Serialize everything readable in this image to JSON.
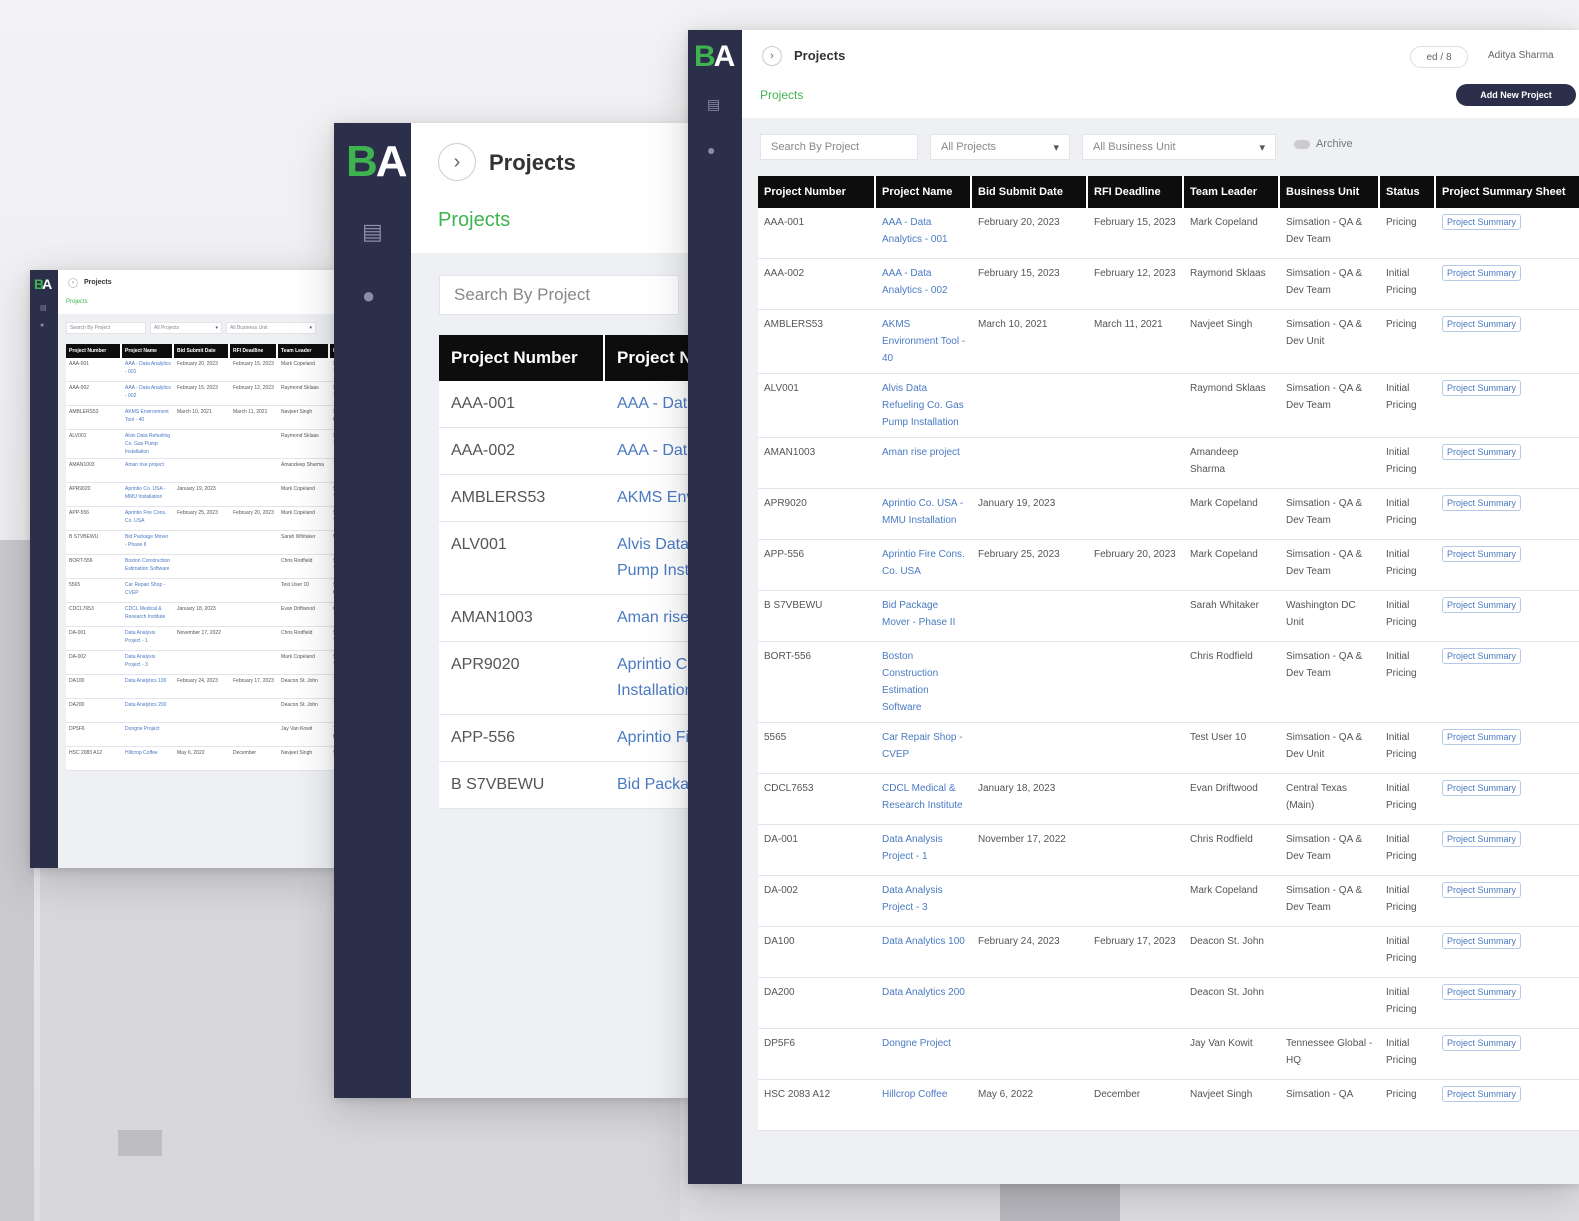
{
  "app": {
    "logo_b": "B",
    "logo_a": "A",
    "page_title": "Projects",
    "breadcrumb": "Projects"
  },
  "header": {
    "notification": "ed / 8",
    "user_name": "Aditya Sharma",
    "add_button": "Add New Project"
  },
  "filters": {
    "search_placeholder": "Search By Project",
    "projects_filter": "All Projects",
    "business_filter": "All Business Unit",
    "archive_label": "Archive"
  },
  "icons": {
    "sidebar_1": "document-icon",
    "sidebar_2": "user-icon",
    "back": "chevron-right-icon"
  },
  "table": {
    "columns": [
      "Project Number",
      "Project Name",
      "Bid Submit Date",
      "RFI Deadline",
      "Team Leader",
      "Business Unit",
      "Status",
      "Project Summary Sheet"
    ],
    "rows": [
      [
        "AAA-001",
        "AAA - Data Analytics - 001",
        "February 20, 2023",
        "February 15, 2023",
        "Mark Copeland",
        "Simsation - QA & Dev Team",
        "Pricing",
        "Project Summary"
      ],
      [
        "AAA-002",
        "AAA - Data Analytics - 002",
        "February 15, 2023",
        "February 12, 2023",
        "Raymond Sklaas",
        "Simsation - QA & Dev Team",
        "Initial Pricing",
        "Project Summary"
      ],
      [
        "AMBLERS53",
        "AKMS Environment Tool - 40",
        "March 10, 2021",
        "March 11, 2021",
        "Navjeet Singh",
        "Simsation - QA & Dev Unit",
        "Pricing",
        "Project Summary"
      ],
      [
        "ALV001",
        "Alvis Data Refueling Co. Gas Pump Installation",
        "",
        "",
        "Raymond Sklaas",
        "Simsation - QA & Dev Team",
        "Initial Pricing",
        "Project Summary"
      ],
      [
        "AMAN1003",
        "Aman rise project",
        "",
        "",
        "Amandeep Sharma",
        "",
        "Initial Pricing",
        "Project Summary"
      ],
      [
        "APR9020",
        "Aprintio Co. USA - MMU Installation",
        "January 19, 2023",
        "",
        "Mark Copeland",
        "Simsation - QA & Dev Team",
        "Initial Pricing",
        "Project Summary"
      ],
      [
        "APP-556",
        "Aprintio Fire Cons. Co. USA",
        "February 25, 2023",
        "February 20, 2023",
        "Mark Copeland",
        "Simsation - QA & Dev Team",
        "Initial Pricing",
        "Project Summary"
      ],
      [
        "B S7VBEWU",
        "Bid Package Mover - Phase II",
        "",
        "",
        "Sarah Whitaker",
        "Washington DC Unit",
        "Initial Pricing",
        "Project Summary"
      ],
      [
        "BORT-556",
        "Boston Construction Estimation Software",
        "",
        "",
        "Chris Rodfield",
        "Simsation - QA & Dev Team",
        "Initial Pricing",
        "Project Summary"
      ],
      [
        "5565",
        "Car Repair Shop - CVEP",
        "",
        "",
        "Test User 10",
        "Simsation - QA & Dev Unit",
        "Initial Pricing",
        "Project Summary"
      ],
      [
        "CDCL7653",
        "CDCL Medical & Research Institute",
        "January 18, 2023",
        "",
        "Evan Driftwood",
        "Central Texas (Main)",
        "Initial Pricing",
        "Project Summary"
      ],
      [
        "DA-001",
        "Data Analysis Project - 1",
        "November 17, 2022",
        "",
        "Chris Rodfield",
        "Simsation - QA & Dev Team",
        "Initial Pricing",
        "Project Summary"
      ],
      [
        "DA-002",
        "Data Analysis Project - 3",
        "",
        "",
        "Mark Copeland",
        "Simsation - QA & Dev Team",
        "Initial Pricing",
        "Project Summary"
      ],
      [
        "DA100",
        "Data Analytics 100",
        "February 24, 2023",
        "February 17, 2023",
        "Deacon St. John",
        "",
        "Initial Pricing",
        "Project Summary"
      ],
      [
        "DA200",
        "Data Analytics 200",
        "",
        "",
        "Deacon St. John",
        "",
        "Initial Pricing",
        "Project Summary"
      ],
      [
        "DP5F6",
        "Dongne Project",
        "",
        "",
        "Jay Van Kowit",
        "Tennessee Global - HQ",
        "Initial Pricing",
        "Project Summary"
      ],
      [
        "HSC 2083 A12",
        "Hillcrop Coffee",
        "May 6, 2022",
        "December",
        "Navjeet Singh",
        "Simsation - QA",
        "Pricing",
        "Project Summary"
      ]
    ]
  }
}
